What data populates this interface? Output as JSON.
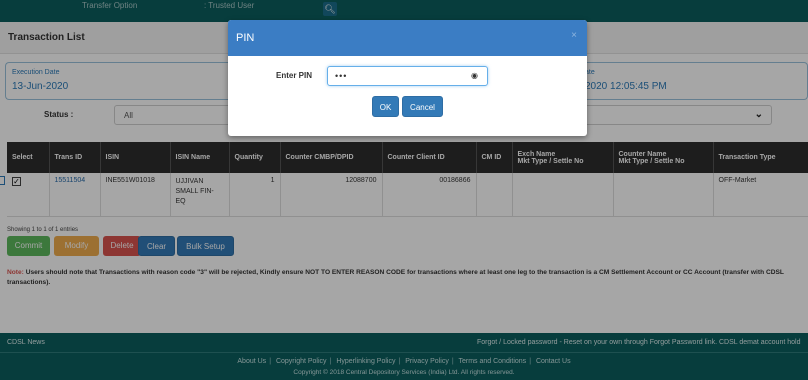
{
  "topbar": {
    "transfer_option_label": "Transfer Option",
    "transfer_option_value": ": Trusted User"
  },
  "page": {
    "title": "Transaction List"
  },
  "execution": {
    "date_label": "Execution Date",
    "date_value": "13-Jun-2020",
    "date_right_label": "ate",
    "date_right_value": "2020 12:05:45 PM"
  },
  "filters": {
    "status_label": "Status :",
    "status_value": "All"
  },
  "table": {
    "headers": [
      "Select",
      "Trans ID",
      "ISIN",
      "ISIN Name",
      "Quantity",
      "Counter CMBP/DPID",
      "Counter Client ID",
      "CM ID",
      "Exch Name\nMkt Type / Settle No",
      "Counter Name\nMkt Type / Settle No",
      "Transaction Type"
    ],
    "rows": [
      {
        "checked": "✓",
        "trans_id": "15511504",
        "isin": "INE551W01018",
        "isin_name": "UJJIVAN SMALL FIN-EQ",
        "quantity": "1",
        "counter_cmbp": "12088700",
        "counter_client": "00186866",
        "cm_id": "",
        "exch_name": "",
        "counter_name": "",
        "transaction_type": "OFF-Market"
      }
    ]
  },
  "pagination": {
    "showing_text": "Showing 1 to 1 of 1 entries"
  },
  "actions": {
    "commit": "Commit",
    "modify": "Modify",
    "delete": "Delete",
    "clear": "Clear",
    "bulk_setup": "Bulk Setup"
  },
  "note": {
    "label": "Note:",
    "text": " Users should note that Transactions with reason code \"3\" will be rejected, Kindly ensure NOT TO ENTER REASON CODE for transactions where at least one leg to the transaction is a CM Settlement Account or CC Account (transfer with CDSL transactions)."
  },
  "footer": {
    "news_label": "CDSL News",
    "marquee": "Forgot / Locked password - Reset on your own through Forgot Password link. CDSL demat account hold",
    "links": [
      "About Us",
      "Copyright Policy",
      "Hyperlinking Policy",
      "Privacy Policy",
      "Terms and Conditions",
      "Contact Us"
    ],
    "copyright": "Copyright © 2018 Central Depository Services (India) Ltd. All rights reserved."
  },
  "modal": {
    "title": "PIN",
    "close": "×",
    "pin_label": "Enter PIN",
    "pin_value": "•••",
    "ok": "OK",
    "cancel": "Cancel"
  },
  "colors": {
    "header_teal": "#0b5e5e",
    "modal_blue": "#3b7dc4",
    "primary": "#337ab7",
    "success": "#5cb85c",
    "warning": "#f0ad4e",
    "danger": "#d9534f"
  }
}
